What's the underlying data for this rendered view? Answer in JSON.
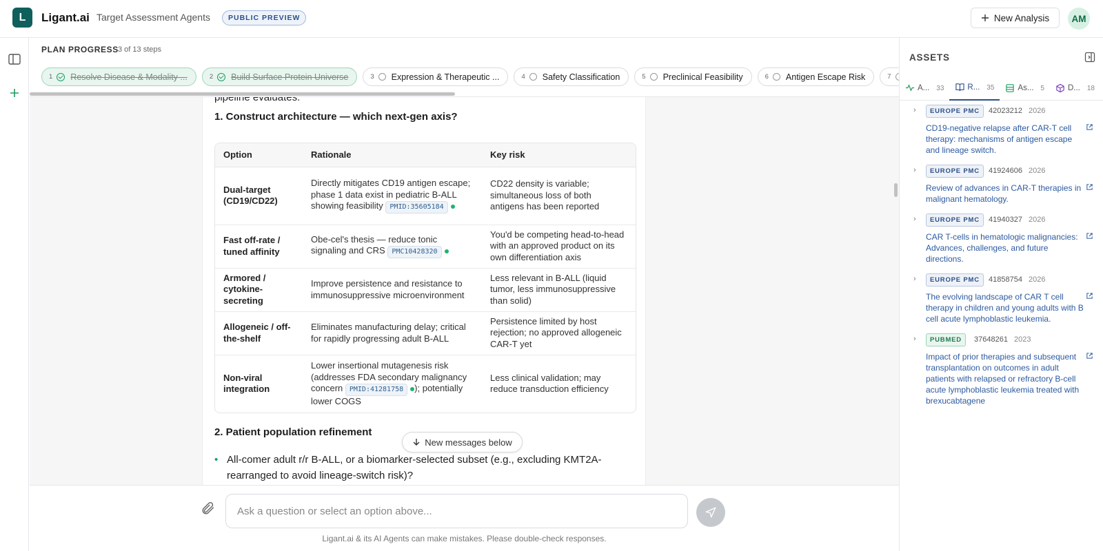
{
  "header": {
    "logo_letter": "L",
    "brand": "Ligant.ai",
    "subtitle": "Target Assessment Agents",
    "badge": "PUBLIC PREVIEW",
    "new_analysis": "New Analysis",
    "avatar": "AM"
  },
  "plan": {
    "title": "PLAN PROGRESS",
    "count": "3 of 13 steps",
    "steps": [
      {
        "num": "1",
        "label": "Resolve Disease & Modality ...",
        "status": "done"
      },
      {
        "num": "2",
        "label": "Build Surface Protein Universe",
        "status": "done"
      },
      {
        "num": "3",
        "label": "Expression & Therapeutic ...",
        "status": "pending"
      },
      {
        "num": "4",
        "label": "Safety Classification",
        "status": "pending"
      },
      {
        "num": "5",
        "label": "Preclinical Feasibility",
        "status": "pending"
      },
      {
        "num": "6",
        "label": "Antigen Escape Risk",
        "status": "pending"
      },
      {
        "num": "7",
        "label": "",
        "status": "pending"
      }
    ]
  },
  "content": {
    "cut_line": "pipeline evaluates.",
    "section1_title": "1. Construct architecture — which next-gen axis?",
    "table_headers": {
      "option": "Option",
      "rationale": "Rationale",
      "risk": "Key risk"
    },
    "rows": [
      {
        "option": "Dual-target (CD19/CD22)",
        "rationale": "Directly mitigates CD19 antigen escape; phase 1 data exist in pediatric B-ALL showing feasibility",
        "cite": "PMID:35605184",
        "rationale_after": "",
        "risk": "CD22 density is variable; simultaneous loss of both antigens has been reported"
      },
      {
        "option": "Fast off-rate / tuned affinity",
        "rationale": "Obe-cel's thesis — reduce tonic signaling and CRS",
        "cite": "PMC10428320",
        "rationale_after": "",
        "risk": "You'd be competing head-to-head with an approved product on its own differentiation axis"
      },
      {
        "option": "Armored / cytokine-secreting",
        "rationale": "Improve persistence and resistance to immunosuppressive microenvironment",
        "cite": "",
        "rationale_after": "",
        "risk": "Less relevant in B-ALL (liquid tumor, less immunosuppressive than solid)"
      },
      {
        "option": "Allogeneic / off-the-shelf",
        "rationale": "Eliminates manufacturing delay; critical for rapidly progressing adult B-ALL",
        "cite": "",
        "rationale_after": "",
        "risk": "Persistence limited by host rejection; no approved allogeneic CAR-T yet"
      },
      {
        "option": "Non-viral integration",
        "rationale": "Lower insertional mutagenesis risk (addresses FDA secondary malignancy concern",
        "cite": "PMID:41281758",
        "rationale_after": "); potentially lower COGS",
        "risk": "Less clinical validation; may reduce transduction efficiency"
      }
    ],
    "section2_title": "2. Patient population refinement",
    "bullet1": "All-comer adult r/r B-ALL, or a biomarker-selected subset (e.g., excluding KMT2A-rearranged to avoid lineage-switch risk)?",
    "new_messages": "New messages below"
  },
  "composer": {
    "placeholder": "Ask a question or select an option above...",
    "disclaimer": "Ligant.ai & its AI Agents can make mistakes. Please double-check responses."
  },
  "assets": {
    "title": "ASSETS",
    "tabs": [
      {
        "label": "A...",
        "count": "33",
        "icon": "activity-icon"
      },
      {
        "label": "R...",
        "count": "35",
        "icon": "book-icon",
        "active": true
      },
      {
        "label": "As...",
        "count": "5",
        "icon": "table-icon"
      },
      {
        "label": "D...",
        "count": "18",
        "icon": "cube-icon"
      }
    ],
    "refs": [
      {
        "source": "EUROPE PMC",
        "id": "42023212",
        "year": "2026",
        "title": "CD19-negative relapse after CAR-T cell therapy: mechanisms of antigen escape and lineage switch."
      },
      {
        "source": "EUROPE PMC",
        "id": "41924606",
        "year": "2026",
        "title": "Review of advances in CAR-T therapies in malignant hematology."
      },
      {
        "source": "EUROPE PMC",
        "id": "41940327",
        "year": "2026",
        "title": "CAR T-cells in hematologic malignancies: Advances, challenges, and future directions."
      },
      {
        "source": "EUROPE PMC",
        "id": "41858754",
        "year": "2026",
        "title": "The evolving landscape of CAR T cell therapy in children and young adults with B cell acute lymphoblastic leukemia."
      },
      {
        "source": "PUBMED",
        "id": "37648261",
        "year": "2023",
        "title": "Impact of prior therapies and subsequent transplantation on outcomes in adult patients with relapsed or refractory B-cell acute lymphoblastic leukemia treated with brexucabtagene"
      }
    ]
  }
}
